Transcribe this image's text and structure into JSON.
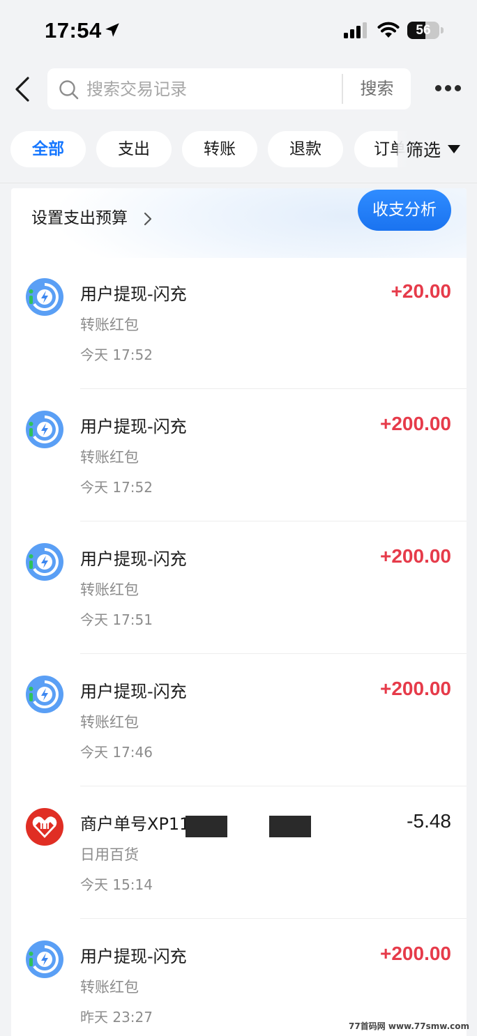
{
  "status_bar": {
    "time": "17:54",
    "battery": "56",
    "battery_level": 0.56
  },
  "search": {
    "placeholder": "搜索交易记录",
    "button_label": "搜索"
  },
  "tabs": [
    {
      "label": "全部",
      "active": true
    },
    {
      "label": "支出",
      "active": false
    },
    {
      "label": "转账",
      "active": false
    },
    {
      "label": "退款",
      "active": false
    },
    {
      "label": "订单",
      "active": false
    }
  ],
  "filter": {
    "label": "筛选"
  },
  "budget": {
    "link_label": "设置支出预算",
    "analysis_button": "收支分析"
  },
  "transactions": [
    {
      "title": "用户提现-闪充",
      "category": "转账红包",
      "time": "今天 17:52",
      "amount": "+20.00",
      "type": "income",
      "icon": "flash-recharge-icon"
    },
    {
      "title": "用户提现-闪充",
      "category": "转账红包",
      "time": "今天 17:52",
      "amount": "+200.00",
      "type": "income",
      "icon": "flash-recharge-icon"
    },
    {
      "title": "用户提现-闪充",
      "category": "转账红包",
      "time": "今天 17:51",
      "amount": "+200.00",
      "type": "income",
      "icon": "flash-recharge-icon"
    },
    {
      "title": "用户提现-闪充",
      "category": "转账红包",
      "time": "今天 17:46",
      "amount": "+200.00",
      "type": "income",
      "icon": "flash-recharge-icon"
    },
    {
      "title": "商户单号XP11",
      "category": "日用百货",
      "time": "今天 15:14",
      "amount": "-5.48",
      "type": "expense",
      "icon": "pinduoduo-logo-icon"
    },
    {
      "title": "用户提现-闪充",
      "category": "转账红包",
      "time": "昨天 23:27",
      "amount": "+200.00",
      "type": "income",
      "icon": "flash-recharge-icon"
    }
  ],
  "colors": {
    "accent": "#1677ff",
    "income": "#e63b4a",
    "expense": "#1a1a1a",
    "background": "#f2f3f5"
  },
  "watermark": "77首码网 www.77smw.com"
}
